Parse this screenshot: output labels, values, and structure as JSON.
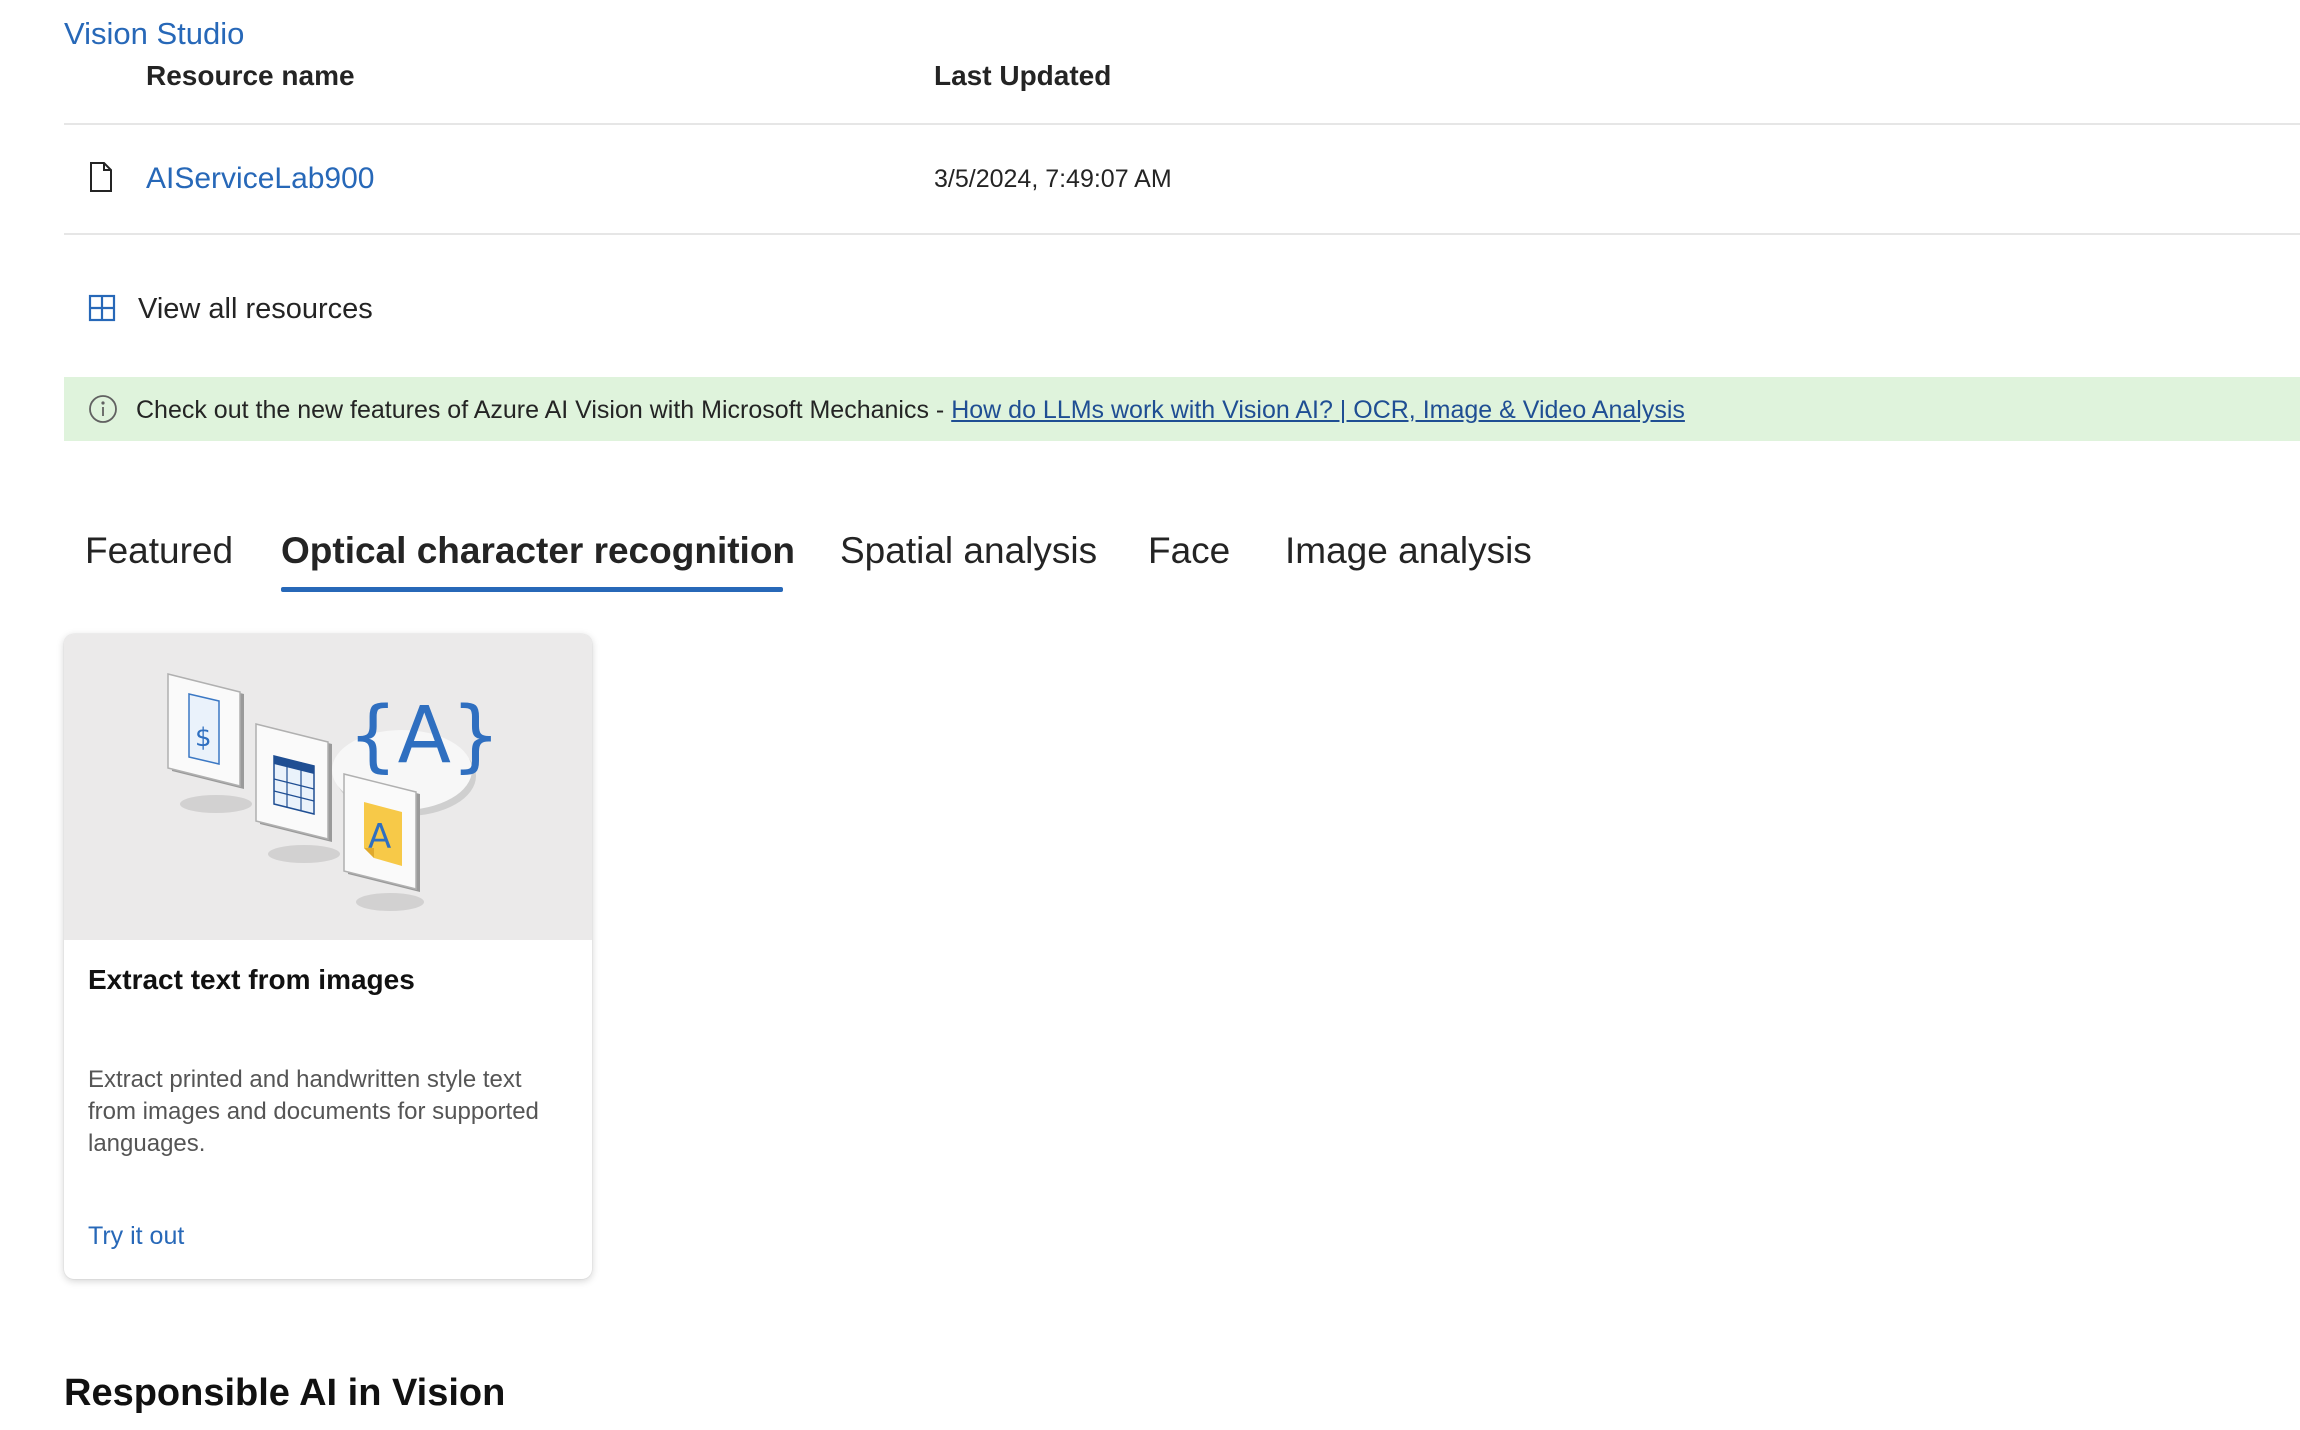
{
  "app": {
    "title": "Vision Studio"
  },
  "resources_table": {
    "columns": [
      "Resource name",
      "Last Updated"
    ],
    "rows": [
      {
        "name": "AIServiceLab900",
        "last_updated": "3/5/2024, 7:49:07 AM",
        "icon": "file-icon"
      }
    ]
  },
  "view_all": {
    "label": "View all resources",
    "icon": "grid-icon"
  },
  "banner": {
    "icon": "info-icon",
    "text": "Check out the new features of Azure AI Vision with Microsoft Mechanics - ",
    "link_text": "How do LLMs work with Vision AI? | OCR, Image & Video Analysis",
    "background": "#dff3dc"
  },
  "tabs": [
    {
      "label": "Featured",
      "active": false
    },
    {
      "label": "Optical character recognition",
      "active": true
    },
    {
      "label": "Spatial analysis",
      "active": false
    },
    {
      "label": "Face",
      "active": false
    },
    {
      "label": "Image analysis",
      "active": false
    }
  ],
  "card": {
    "title": "Extract text from images",
    "description": "Extract printed and handwritten style text from images and documents for supported languages.",
    "cta": "Try it out",
    "illustration_letters": {
      "braces": "{A}",
      "note": "A",
      "receipt": "$"
    }
  },
  "section": {
    "heading": "Responsible AI in Vision"
  },
  "colors": {
    "accent": "#2768b8",
    "link_dark": "#1f4e93",
    "text": "#242424"
  }
}
